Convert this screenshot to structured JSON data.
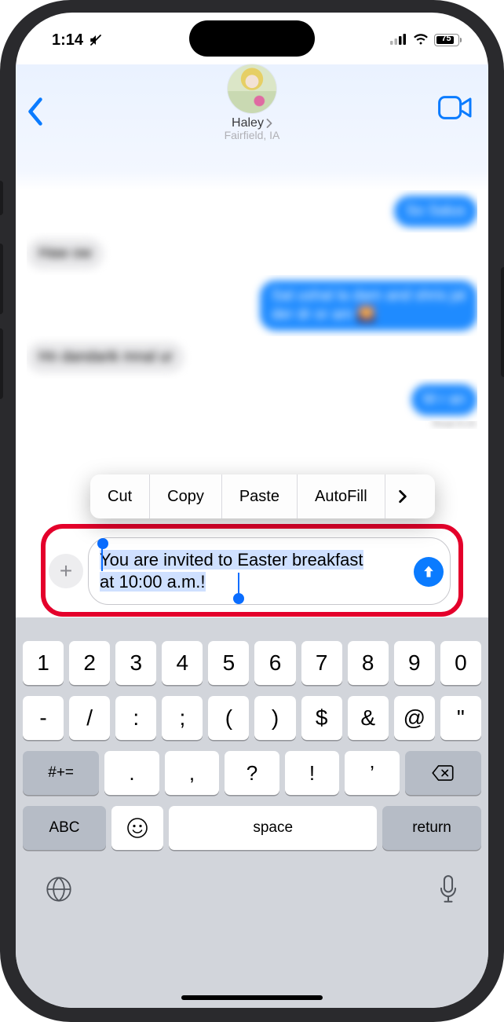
{
  "status": {
    "time": "1:14",
    "battery": "75"
  },
  "header": {
    "contact_name": "Haley",
    "contact_loc": "Fairfield, IA"
  },
  "edit_menu": {
    "cut": "Cut",
    "copy": "Copy",
    "paste": "Paste",
    "autofill": "AutoFill"
  },
  "compose": {
    "text_line1": "You are invited to Easter breakfast",
    "text_line2": "at 10:00 a.m.!"
  },
  "keyboard": {
    "row1": [
      "1",
      "2",
      "3",
      "4",
      "5",
      "6",
      "7",
      "8",
      "9",
      "0"
    ],
    "row2": [
      "-",
      "/",
      ":",
      ";",
      "(",
      ")",
      "$",
      "&",
      "@",
      "\""
    ],
    "row3_mode": "#+=",
    "row3": [
      ".",
      ",",
      "?",
      "!",
      "’"
    ],
    "row4_abc": "ABC",
    "space": "space",
    "return": "return"
  }
}
